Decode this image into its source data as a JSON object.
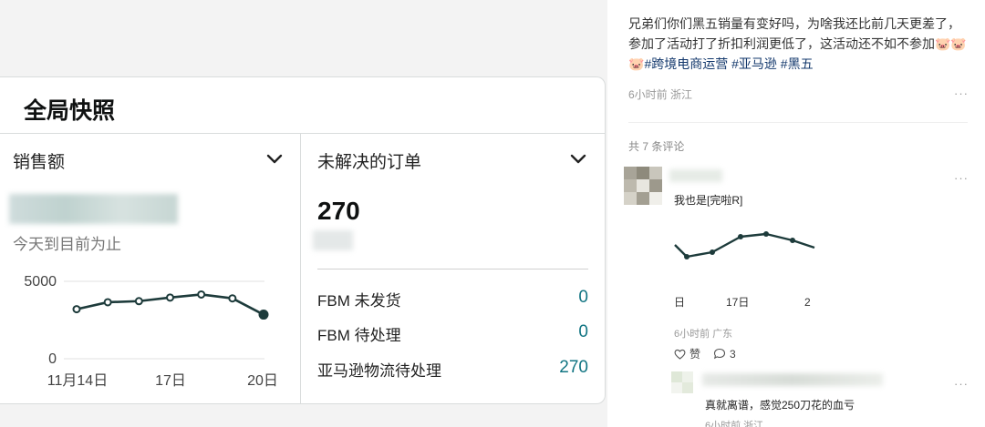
{
  "dashboard": {
    "title": "全局快照",
    "sales": {
      "title": "销售额",
      "subtitle": "今天到目前为止",
      "chart": {
        "y_ticks": [
          "5000",
          "0"
        ],
        "x_ticks": [
          "11月14日",
          "17日",
          "20日"
        ],
        "values": [
          3200,
          3650,
          3720,
          3950,
          4150,
          3900,
          2850
        ]
      }
    },
    "orders": {
      "title": "未解决的订单",
      "count": "270",
      "rows": [
        {
          "label": "FBM 未发货",
          "value": "0"
        },
        {
          "label": "FBM 待处理",
          "value": "0"
        },
        {
          "label": "亚马逊物流待处理",
          "value": "270"
        }
      ]
    },
    "colors": {
      "accent": "#127583",
      "line": "#1d3b3b"
    }
  },
  "social": {
    "post": {
      "text": "兄弟们你们黑五销量有变好吗，为啥我还比前几天更差了，参加了活动打了折扣利润更低了，这活动还不如不参加🐷🐷🐷",
      "tags": "#跨境电商运营 #亚马逊 #黑五",
      "meta": "6小时前 浙江",
      "more": "···"
    },
    "comments_count": "共 7 条评论",
    "comments": [
      {
        "text": "我也是[完啦R]",
        "meta": "6小时前 广东",
        "like_label": "赞",
        "reply_count": "3",
        "more": "···",
        "chart": {
          "x_ticks": [
            "日",
            "17日",
            "2"
          ]
        }
      },
      {
        "text": "真就离谱，感觉250刀花的血亏",
        "meta": "6小时前 浙江",
        "more": "···"
      }
    ]
  }
}
